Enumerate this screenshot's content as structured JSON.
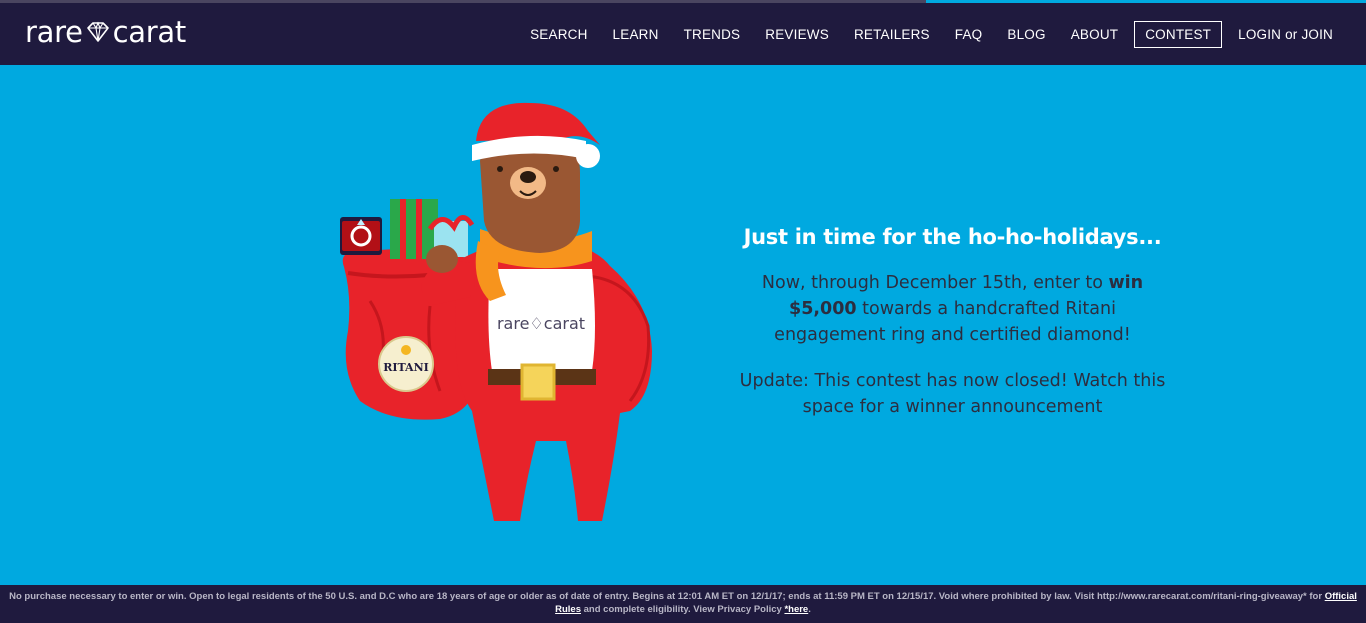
{
  "brand": {
    "left": "rare",
    "right": "carat"
  },
  "nav": {
    "items": [
      "SEARCH",
      "LEARN",
      "TRENDS",
      "REVIEWS",
      "RETAILERS",
      "FAQ",
      "BLOG",
      "ABOUT"
    ],
    "contest": "CONTEST",
    "login": "LOGIN or JOIN"
  },
  "illustration": {
    "shirt_brand_left": "rare",
    "shirt_brand_right": "carat",
    "badge": "RITANI"
  },
  "hero": {
    "headline": "Just in time for the ho-ho-holidays...",
    "p1_a": "Now, through December 15th, enter to ",
    "p1_b": "win",
    "p1_c": "$5,000",
    "p1_d": " towards a handcrafted Ritani engagement ring and certified diamond!",
    "update": "Update: This contest has now closed! Watch this space for a winner announcement"
  },
  "footer": {
    "text_a": "No purchase necessary to enter or win. Open to legal residents of the 50 U.S. and D.C who are 18 years of age or older as of date of entry. Begins at 12:01 AM ET on 12/1/17; ends at 11:59 PM ET on 12/15/17. Void where prohibited by law. Visit http://www.rarecarat.com/ritani-ring-giveaway* for ",
    "rules_link": "Official Rules",
    "text_b": " and complete eligibility. View Privacy Policy ",
    "here_link": "*here",
    "text_c": "."
  },
  "colors": {
    "navbar": "#1f1a3e",
    "hero_bg": "#00a9e0",
    "santa_red": "#e8232a",
    "bear_brown": "#9a5733",
    "scarf_orange": "#f7941d"
  }
}
